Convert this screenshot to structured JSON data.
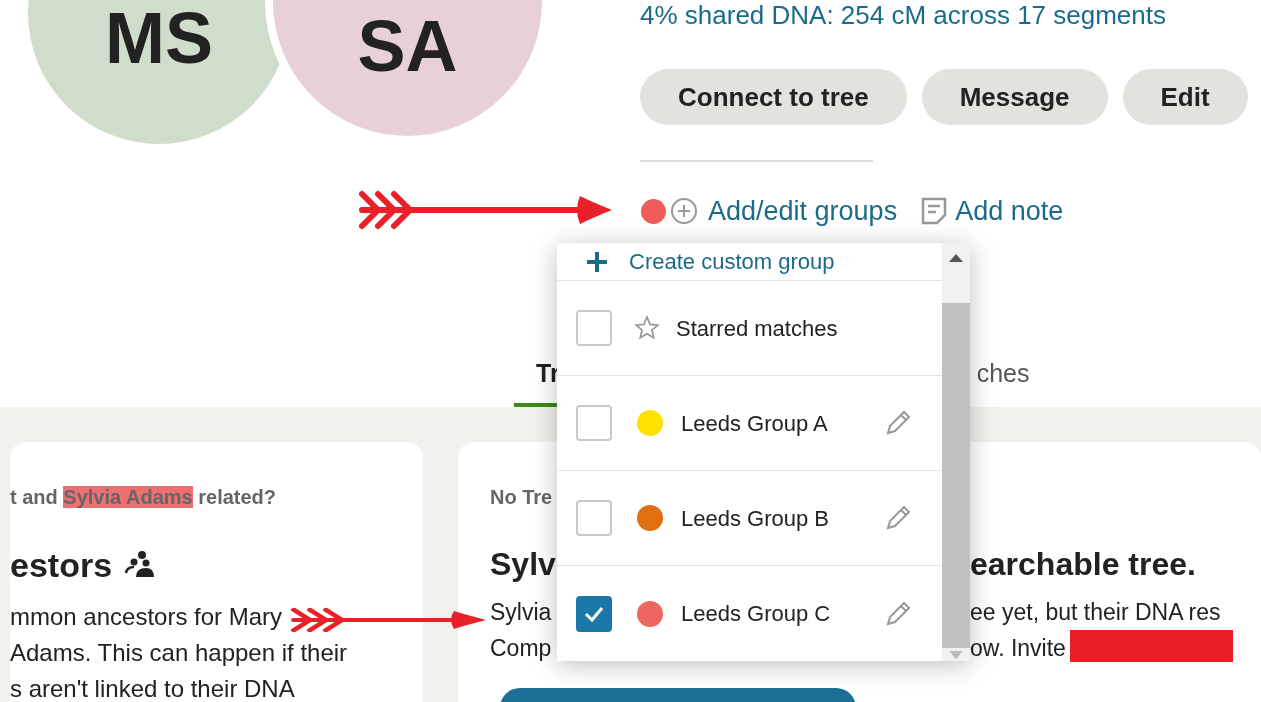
{
  "match": {
    "avatars": [
      {
        "initials": "MS",
        "color": "#d0ddca"
      },
      {
        "initials": "SA",
        "color": "#e8d0d8"
      }
    ],
    "shared_dna": "4% shared DNA: 254 cM across 17 segments"
  },
  "actions": [
    "Connect to tree",
    "Message",
    "Edit"
  ],
  "groups_bar": {
    "group_dots": [
      {
        "color": "#ee5d5a"
      }
    ],
    "add_groups": "Add/edit groups",
    "add_note": "Add note"
  },
  "group_menu": {
    "create": "Create custom group",
    "items": [
      {
        "kind": "starred",
        "label": "Starred matches",
        "checked": false
      },
      {
        "kind": "group",
        "label": "Leeds Group A",
        "color": "#fde200",
        "checked": false
      },
      {
        "kind": "group",
        "label": "Leeds Group B",
        "color": "#e0700f",
        "checked": false
      },
      {
        "kind": "group",
        "label": "Leeds Group C",
        "color": "#ee6660",
        "checked": true
      }
    ]
  },
  "tabs": [
    {
      "label": "Tr",
      "selected": true
    },
    {
      "label": "ches",
      "selected": false
    }
  ],
  "left_card": {
    "question": {
      "before": "t and",
      "highlighted": "Sylvia Adams",
      "after": "related?"
    },
    "heading": "estors",
    "body_lines": [
      "mmon ancestors for Mary",
      "Adams. This can happen if their",
      "s aren't linked to their DNA"
    ]
  },
  "right_card": {
    "label": "No Tre",
    "heading": [
      "Sylv",
      "earchable tree."
    ],
    "body_lines": [
      [
        "Sylvia",
        "ee yet, but their DNA res"
      ],
      [
        "Comp",
        "ow. Invite"
      ]
    ]
  }
}
